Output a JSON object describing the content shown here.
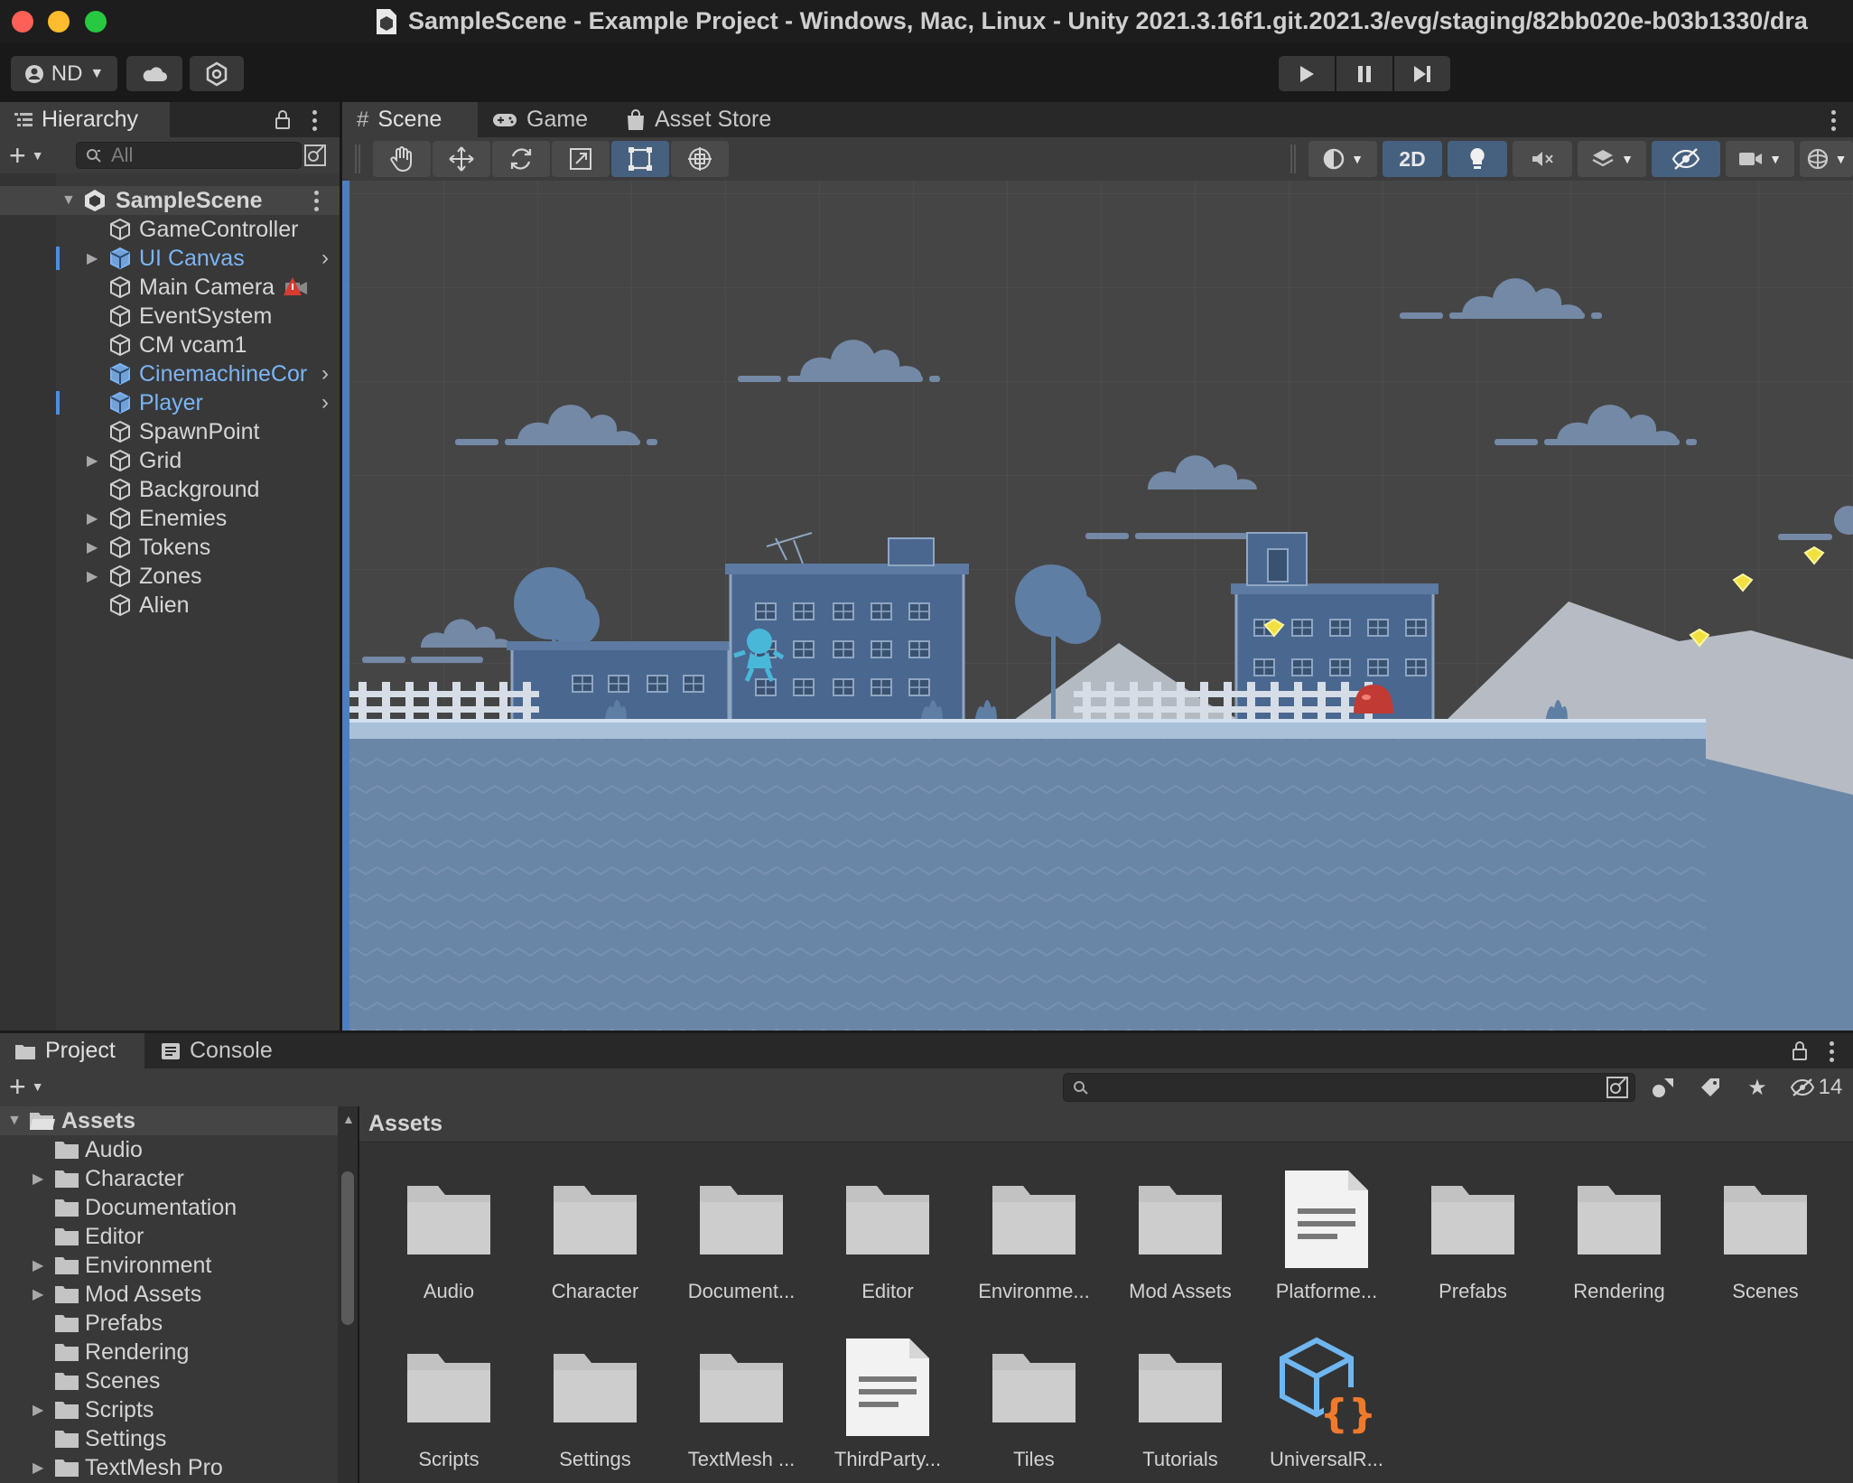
{
  "window": {
    "title": "SampleScene - Example Project - Windows, Mac, Linux - Unity 2021.3.16f1.git.2021.3/evg/staging/82bb020e-b03b1330/dra"
  },
  "toolbar": {
    "account_label": "ND",
    "icons": [
      "account-icon",
      "cloud-icon",
      "collab-icon",
      "play-icon",
      "pause-icon",
      "step-icon"
    ]
  },
  "hierarchy": {
    "tab_label": "Hierarchy",
    "search_placeholder": "All",
    "scene_name": "SampleScene",
    "items": [
      {
        "label": "GameController",
        "expandable": false,
        "prefab": false
      },
      {
        "label": "UI Canvas",
        "expandable": true,
        "prefab": true
      },
      {
        "label": "Main Camera",
        "expandable": false,
        "prefab": false
      },
      {
        "label": "EventSystem",
        "expandable": false,
        "prefab": false
      },
      {
        "label": "CM vcam1",
        "expandable": false,
        "prefab": false
      },
      {
        "label": "CinemachineCor",
        "expandable": false,
        "prefab": true
      },
      {
        "label": "Player",
        "expandable": false,
        "prefab": true
      },
      {
        "label": "SpawnPoint",
        "expandable": false,
        "prefab": false
      },
      {
        "label": "Grid",
        "expandable": true,
        "prefab": false
      },
      {
        "label": "Background",
        "expandable": false,
        "prefab": false
      },
      {
        "label": "Enemies",
        "expandable": true,
        "prefab": false
      },
      {
        "label": "Tokens",
        "expandable": true,
        "prefab": false
      },
      {
        "label": "Zones",
        "expandable": true,
        "prefab": false
      },
      {
        "label": "Alien",
        "expandable": false,
        "prefab": false
      }
    ]
  },
  "scene_panel": {
    "tabs": [
      {
        "label": "Scene",
        "active": true,
        "icon": "grid-icon"
      },
      {
        "label": "Game",
        "active": false,
        "icon": "gamepad-icon"
      },
      {
        "label": "Asset Store",
        "active": false,
        "icon": "store-icon"
      }
    ],
    "toggle_2d_label": "2D",
    "tools": [
      "hand-tool-icon",
      "move-tool-icon",
      "rotate-tool-icon",
      "scale-tool-icon",
      "rect-tool-icon",
      "transform-tool-icon"
    ],
    "selected_tool": "rect-tool-icon"
  },
  "project_panel": {
    "tabs": [
      {
        "label": "Project",
        "active": true,
        "icon": "folder-icon"
      },
      {
        "label": "Console",
        "active": false,
        "icon": "console-icon"
      }
    ],
    "hidden_count": "14",
    "tree_root": "Assets",
    "tree": [
      {
        "label": "Audio",
        "expandable": false
      },
      {
        "label": "Character",
        "expandable": true
      },
      {
        "label": "Documentation",
        "expandable": false
      },
      {
        "label": "Editor",
        "expandable": false
      },
      {
        "label": "Environment",
        "expandable": true
      },
      {
        "label": "Mod Assets",
        "expandable": true
      },
      {
        "label": "Prefabs",
        "expandable": false
      },
      {
        "label": "Rendering",
        "expandable": false
      },
      {
        "label": "Scenes",
        "expandable": false
      },
      {
        "label": "Scripts",
        "expandable": true
      },
      {
        "label": "Settings",
        "expandable": false
      },
      {
        "label": "TextMesh Pro",
        "expandable": true
      }
    ],
    "breadcrumb": "Assets",
    "grid": [
      {
        "label": "Audio",
        "kind": "folder"
      },
      {
        "label": "Character",
        "kind": "folder"
      },
      {
        "label": "Document...",
        "kind": "folder"
      },
      {
        "label": "Editor",
        "kind": "folder"
      },
      {
        "label": "Environme...",
        "kind": "folder"
      },
      {
        "label": "Mod Assets",
        "kind": "folder"
      },
      {
        "label": "Platforme...",
        "kind": "document"
      },
      {
        "label": "Prefabs",
        "kind": "folder"
      },
      {
        "label": "Rendering",
        "kind": "folder"
      },
      {
        "label": "Scenes",
        "kind": "folder"
      },
      {
        "label": "Scripts",
        "kind": "folder"
      },
      {
        "label": "Settings",
        "kind": "folder"
      },
      {
        "label": "TextMesh ...",
        "kind": "folder"
      },
      {
        "label": "ThirdParty...",
        "kind": "document"
      },
      {
        "label": "Tiles",
        "kind": "folder"
      },
      {
        "label": "Tutorials",
        "kind": "folder"
      },
      {
        "label": "UniversalR...",
        "kind": "package"
      }
    ]
  },
  "colors": {
    "accent_blue": "#46607f",
    "prefab_text": "#7cb4f4",
    "scene_bg": "#454545",
    "scene_ground": "#6a86a6"
  }
}
